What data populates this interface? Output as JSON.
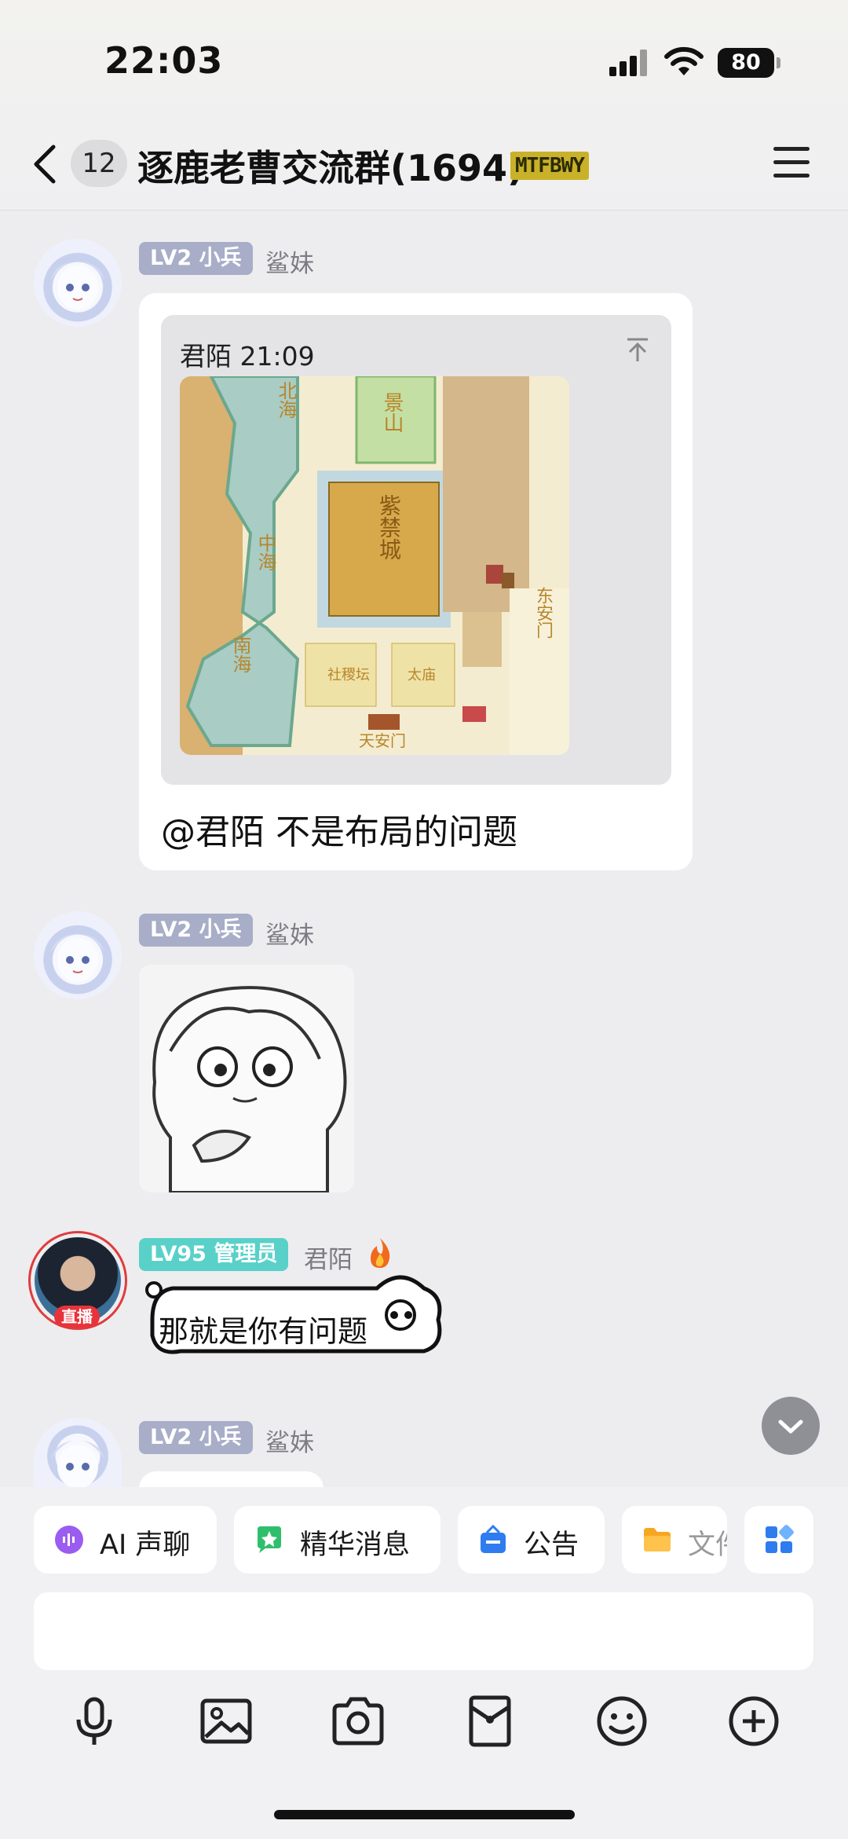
{
  "status_bar": {
    "time": "22:03",
    "battery": "80"
  },
  "header": {
    "unread_count": "12",
    "title": "逐鹿老曹交流群(1694)",
    "tag": "MTFBWY"
  },
  "messages": [
    {
      "level": "LV2 小兵",
      "nickname": "鲨妹",
      "quote_sender_time": "君陌 21:09",
      "text": "@君陌 不是布局的问题"
    },
    {
      "level": "LV2 小兵",
      "nickname": "鲨妹"
    },
    {
      "level": "LV95 管理员",
      "nickname": "君陌",
      "live_label": "直播",
      "text": "那就是你有问题"
    },
    {
      "level": "LV2 小兵",
      "nickname": "鲨妹"
    }
  ],
  "map_labels": {
    "beihai": "北海",
    "jingshan": "景山",
    "zhonghai": "中海",
    "zijincheng": "紫禁城",
    "nanhai": "南海",
    "dongan": "东安门",
    "sheji": "社稷坛",
    "taimiao": "太庙",
    "tiananmen": "天安门"
  },
  "quick_actions": [
    {
      "label": "AI 声聊",
      "icon": "ai-voice-icon"
    },
    {
      "label": "精华消息",
      "icon": "essence-icon"
    },
    {
      "label": "公告",
      "icon": "announcement-icon"
    },
    {
      "label": "文件",
      "icon": "folder-icon"
    }
  ],
  "colors": {
    "background": "#ededf0",
    "level_lv2": "#a8adc8",
    "level_admin": "#59d1c9",
    "live_red": "#e8333a"
  }
}
